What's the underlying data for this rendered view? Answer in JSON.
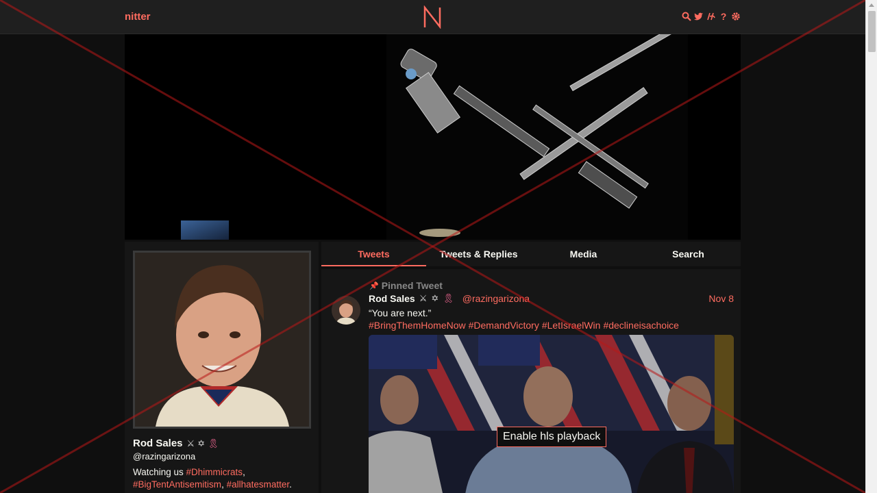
{
  "nav": {
    "brand": "nitter",
    "logo_letter": "N"
  },
  "tabs": [
    {
      "label": "Tweets",
      "active": true
    },
    {
      "label": "Tweets & Replies",
      "active": false
    },
    {
      "label": "Media",
      "active": false
    },
    {
      "label": "Search",
      "active": false
    }
  ],
  "profile": {
    "name": "Rod Sales",
    "handle": "@razingarizona",
    "bio_prefix": "Watching us ",
    "bio_tag1": "#Dhimmicrats",
    "bio_sep1": ",",
    "bio_tag2": "#BigTentAntisemitism",
    "bio_sep2": ", ",
    "bio_tag3": "#allhatesmatter",
    "bio_end": "."
  },
  "tweet": {
    "pinned_label": "Pinned Tweet",
    "name": "Rod Sales",
    "handle": "@razingarizona",
    "date": "Nov 8",
    "text": "“You are next.”",
    "hashtags": [
      "#BringThemHomeNow",
      "#DemandVictory",
      "#LetIsraelWin",
      "#declineisachoice"
    ],
    "media_button": "Enable hls playback"
  },
  "colors": {
    "accent": "#ff6c60",
    "background": "#0f0f0f",
    "panel": "#161616"
  }
}
